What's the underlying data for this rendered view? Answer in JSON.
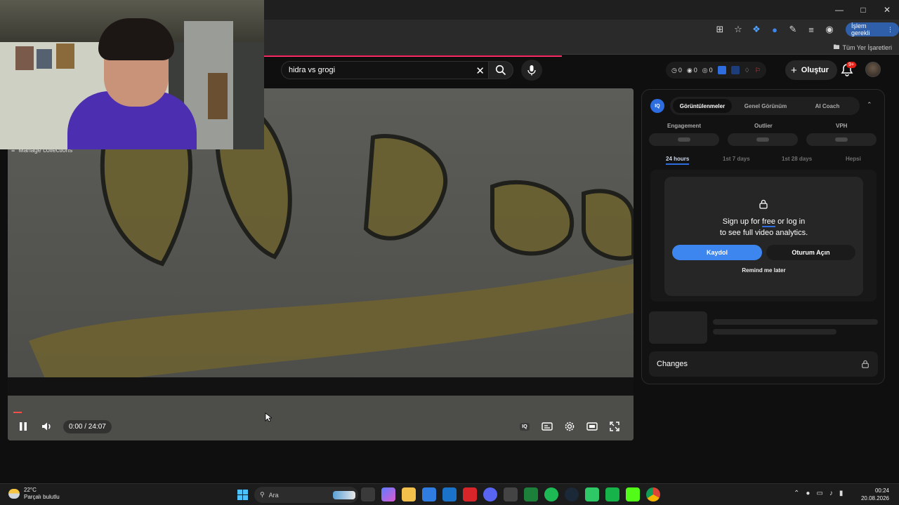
{
  "browser": {
    "action_required_label": "İşlem gerekli",
    "bookmarks_all_label": "Tüm Yer İşaretleri"
  },
  "youtube": {
    "search": {
      "query": "hidra vs grogi"
    },
    "stats": {
      "v1": "0",
      "v2": "0",
      "v3": "0"
    },
    "create_label": "Oluştur",
    "notification_badge": "9+"
  },
  "player": {
    "manage_collections": "Manage collections",
    "time": "0:00 / 24:07",
    "progress_fraction": 0.0,
    "iq_badge": "IQ"
  },
  "analytics_panel": {
    "logo": "IQ",
    "tabs": [
      {
        "label": "Görüntülenmeler",
        "active": true
      },
      {
        "label": "Genel Görünüm",
        "active": false
      },
      {
        "label": "AI Coach",
        "active": false
      }
    ],
    "metrics": [
      "Engagement",
      "Outlier",
      "VPH"
    ],
    "periods": [
      {
        "label": "24 hours",
        "active": true
      },
      {
        "label": "1st 7 days",
        "active": false
      },
      {
        "label": "1st 28 days",
        "active": false
      },
      {
        "label": "Hepsi",
        "active": false
      }
    ],
    "modal": {
      "line1_pre": "Sign up for ",
      "line1_free": "free",
      "line1_post": " or log in",
      "line2": "to see full video analytics.",
      "signup_button": "Kaydol",
      "login_button": "Oturum Açın",
      "remind_label": "Remind me later"
    },
    "changes_label": "Changes"
  },
  "taskbar": {
    "weather_temp": "22°C",
    "weather_desc": "Parçalı bulutlu",
    "search_placeholder": "Ara",
    "time": "00:24",
    "date": "20.08.2026"
  },
  "colors": {
    "accent": "#2d6de0",
    "signup": "#3d86f0",
    "loadbar": "#ff2f6a",
    "yt_red": "#e62117"
  },
  "icons": [
    "minimize-icon",
    "maximize-icon",
    "close-icon",
    "search-icon",
    "mic-icon",
    "bell-icon",
    "plus-icon",
    "lock-icon",
    "pause-icon",
    "volume-icon",
    "captions-icon",
    "settings-icon",
    "theater-icon",
    "fullscreen-icon",
    "folder-icon"
  ]
}
